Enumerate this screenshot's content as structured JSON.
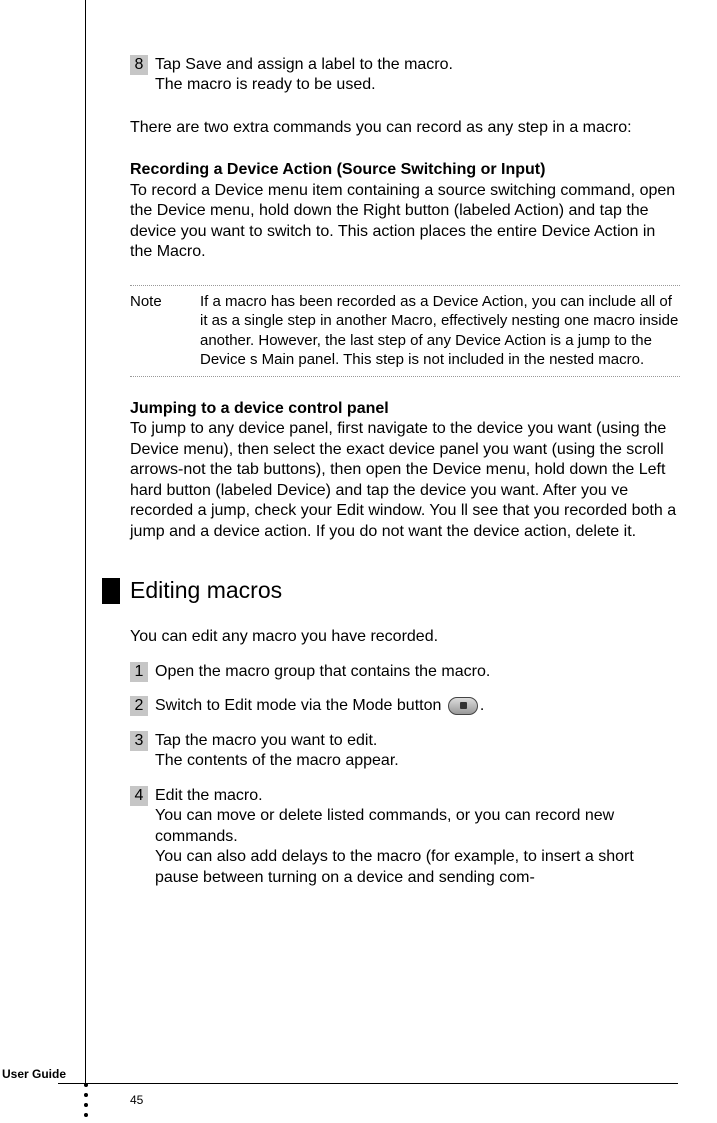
{
  "step8": {
    "num": "8",
    "line1": "Tap Save and assign a label to the macro.",
    "line2": "The macro is ready to be used."
  },
  "extra_commands_intro": "There are two extra commands you can record as any step in a macro:",
  "recording_heading": "Recording a Device Action (Source Switching or Input)",
  "recording_body": "To record a Device menu item containing a source switching command, open the Device menu, hold down the Right button (labeled Action) and tap the device you want to switch to. This action places the entire Device Action in the Macro.",
  "note": {
    "label": "Note",
    "body": "If a macro has been recorded as a Device Action, you can include all of it as a single step in another Macro, effectively nesting one macro inside another. However, the last step of any Device Action is a jump to the Device s Main panel. This step is not included in the nested macro."
  },
  "jumping_heading": "Jumping to a device control panel",
  "jumping_body": "To jump to any device panel, first navigate to the device you want (using the Device menu), then select the exact device panel you want (using the scroll arrows-not the tab buttons), then open the Device menu, hold down the Left hard button (labeled Device) and tap the device you want. After you ve recorded a jump, check your Edit window. You ll see that you recorded both a jump and a device action. If you do not want the device action, delete it.",
  "editing_heading": "Editing macros",
  "editing_intro": "You can edit any macro you have recorded.",
  "edit_steps": {
    "s1": {
      "num": "1",
      "body": "Open the macro group that contains the macro."
    },
    "s2": {
      "num": "2",
      "body_pre": "Switch to Edit mode via the Mode button ",
      "body_post": "."
    },
    "s3": {
      "num": "3",
      "line1": "Tap the macro you want to edit.",
      "line2": "The contents of the macro appear."
    },
    "s4": {
      "num": "4",
      "line1": "Edit the macro.",
      "line2": "You can move or delete listed commands, or you can record new commands.",
      "line3": "You can also add delays to the macro (for example, to insert a short pause between turning on a device and sending com-"
    }
  },
  "footer": {
    "label": "User Guide",
    "page": "45"
  }
}
